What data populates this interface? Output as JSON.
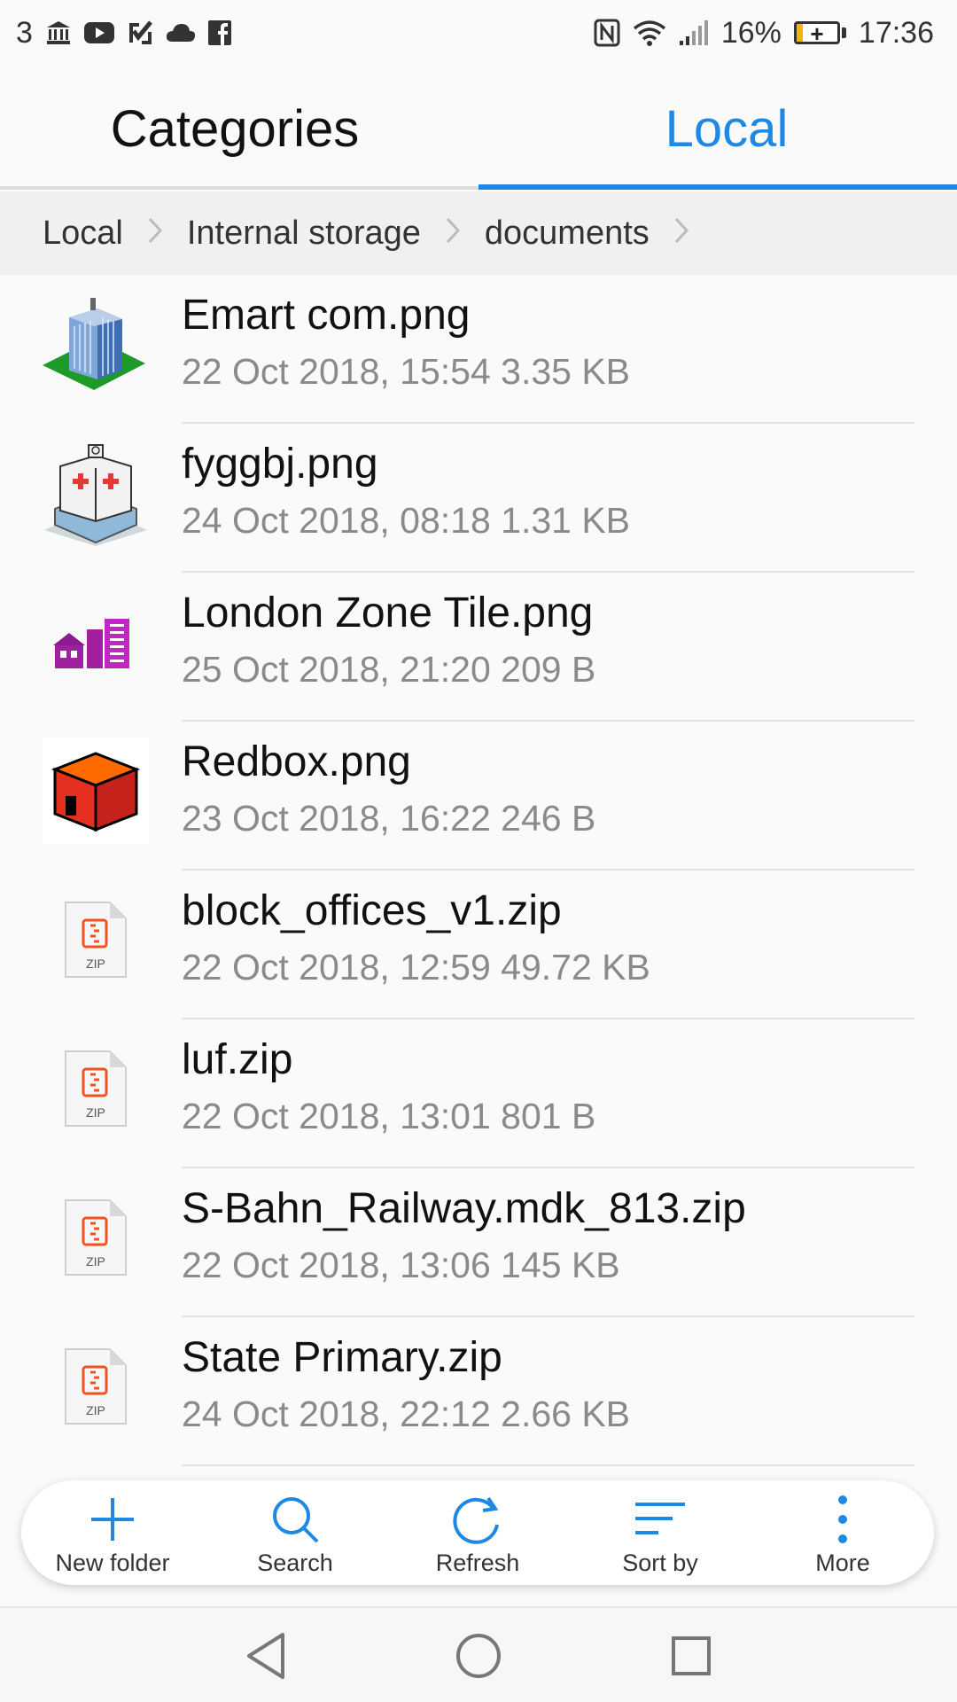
{
  "status_bar": {
    "notification_count": "3",
    "battery_percent": "16%",
    "battery_level": 0.16,
    "time": "17:36",
    "left_icons": [
      "bank-icon",
      "youtube-icon",
      "check-box-icon",
      "cloud-icon",
      "facebook-icon"
    ],
    "right_icons": [
      "nfc-icon",
      "wifi-icon",
      "signal-icon",
      "battery-icon"
    ]
  },
  "tabs": [
    {
      "label": "Categories",
      "active": false
    },
    {
      "label": "Local",
      "active": true
    }
  ],
  "breadcrumb": [
    "Local",
    "Internal storage",
    "documents"
  ],
  "files": [
    {
      "name": "Emart com.png",
      "meta": "22 Oct 2018, 15:54 3.35 KB",
      "thumb": "building-tower-thumbnail"
    },
    {
      "name": "fyggbj.png",
      "meta": "24 Oct 2018, 08:18 1.31 KB",
      "thumb": "hospital-thumbnail"
    },
    {
      "name": "London Zone Tile.png",
      "meta": "25 Oct 2018, 21:20 209 B",
      "thumb": "zone-tile-thumbnail"
    },
    {
      "name": "Redbox.png",
      "meta": "23 Oct 2018, 16:22 246 B",
      "thumb": "red-box-thumbnail"
    },
    {
      "name": "block_offices_v1.zip",
      "meta": "22 Oct 2018, 12:59 49.72 KB",
      "thumb": "zip-file-icon"
    },
    {
      "name": "luf.zip",
      "meta": "22 Oct 2018, 13:01 801 B",
      "thumb": "zip-file-icon"
    },
    {
      "name": "S-Bahn_Railway.mdk_813.zip",
      "meta": "22 Oct 2018, 13:06 145 KB",
      "thumb": "zip-file-icon"
    },
    {
      "name": "State Primary.zip",
      "meta": "24 Oct 2018, 22:12 2.66 KB",
      "thumb": "zip-file-icon"
    }
  ],
  "zip_label": "ZIP",
  "actions": [
    {
      "label": "New folder",
      "icon": "plus-icon"
    },
    {
      "label": "Search",
      "icon": "search-icon"
    },
    {
      "label": "Refresh",
      "icon": "refresh-icon"
    },
    {
      "label": "Sort by",
      "icon": "sort-icon"
    },
    {
      "label": "More",
      "icon": "more-vertical-icon"
    }
  ],
  "nav": [
    "back-icon",
    "home-icon",
    "recents-icon"
  ],
  "colors": {
    "accent": "#1e88e5",
    "zip_orange": "#f4511e"
  }
}
